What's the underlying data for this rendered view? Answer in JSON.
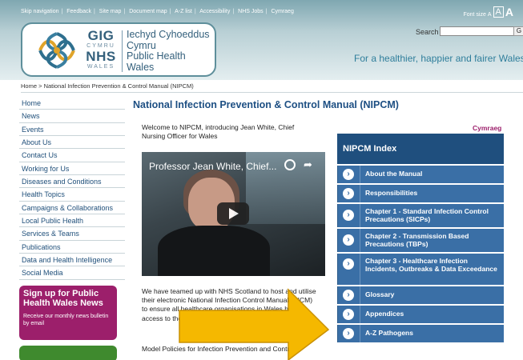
{
  "toplinks": [
    "Skip navigation",
    "Feedback",
    "Site map",
    "Document map",
    "A-Z list",
    "Accessibility",
    "NHS Jobs",
    "Cymraeg"
  ],
  "fontsize": {
    "label": "Font size",
    "small": "A",
    "medium": "A",
    "large": "A"
  },
  "logo": {
    "gig": "GIG",
    "cymru": "CYMRU",
    "nhs": "NHS",
    "wales": "WALES",
    "lines": [
      "Iechyd Cyhoeddus",
      "Cymru",
      "Public Health",
      "Wales"
    ]
  },
  "search": {
    "label": "Search",
    "placeholder": "",
    "go": "G"
  },
  "tagline": "For a healthier, happier and fairer Wales",
  "breadcrumb": {
    "home": "Home",
    "sep": ">",
    "current": "National Infection Prevention & Control Manual (NIPCM)"
  },
  "sidenav": [
    "Home",
    "News",
    "Events",
    "About Us",
    "Contact Us",
    "Working for Us",
    "Diseases and Conditions",
    "Health Topics",
    "Campaigns & Collaborations",
    "Local Public Health",
    "Services & Teams",
    "Publications",
    "Data and Health Intelligence",
    "Social Media"
  ],
  "promo": {
    "title": "Sign up for Public Health Wales News",
    "sub": "Receive our monthly news bulletin by email"
  },
  "page_title": "National Infection Prevention & Control Manual (NIPCM)",
  "intro": "Welcome to NIPCM, introducing Jean White, Chief Nursing Officer for Wales",
  "cymraeg": "Cymraeg",
  "video": {
    "title": "Professor Jean White, Chief..."
  },
  "body_text": "We have teamed up with NHS Scotland to host and utilise their electronic National Infection Control Manual (NICM) to ensure all healthcare organisations in Wales have access to the latest infection prevention polices to support",
  "body_text2": "Model Policies for Infection Prevention and Control",
  "index": {
    "heading": "NIPCM Index",
    "items": [
      "About the Manual",
      "Responsibilities",
      "Chapter 1 - Standard Infection Control Precautions (SICPs)",
      "Chapter 2 - Transmission Based Precautions (TBPs)",
      "Chapter 3 - Healthcare Infection Incidents, Outbreaks & Data Exceedance",
      "Glossary",
      "Appendices",
      "A-Z Pathogens"
    ]
  },
  "colors": {
    "nav_link": "#1f4f7a",
    "index_bg": "#3a6fa6",
    "index_head": "#1f4f7e",
    "promo": "#9c1f6b",
    "arrow": "#f5b800"
  }
}
